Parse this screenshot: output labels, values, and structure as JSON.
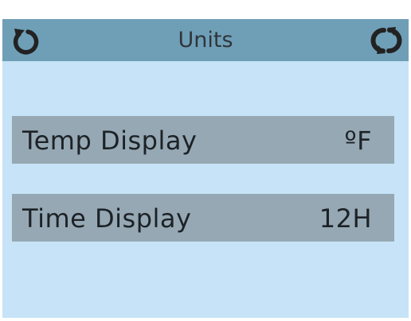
{
  "header": {
    "title": "Units",
    "back_icon": "back-arrow-icon",
    "refresh_icon": "refresh-icon"
  },
  "settings": [
    {
      "label": "Temp Display",
      "value": "ºF"
    },
    {
      "label": "Time Display",
      "value": "12H"
    }
  ],
  "colors": {
    "header_bg": "#6f9fb7",
    "screen_bg": "#c6e3f7",
    "row_bg": "#96a8b3",
    "text": "#1c2227",
    "icon": "#222222"
  }
}
